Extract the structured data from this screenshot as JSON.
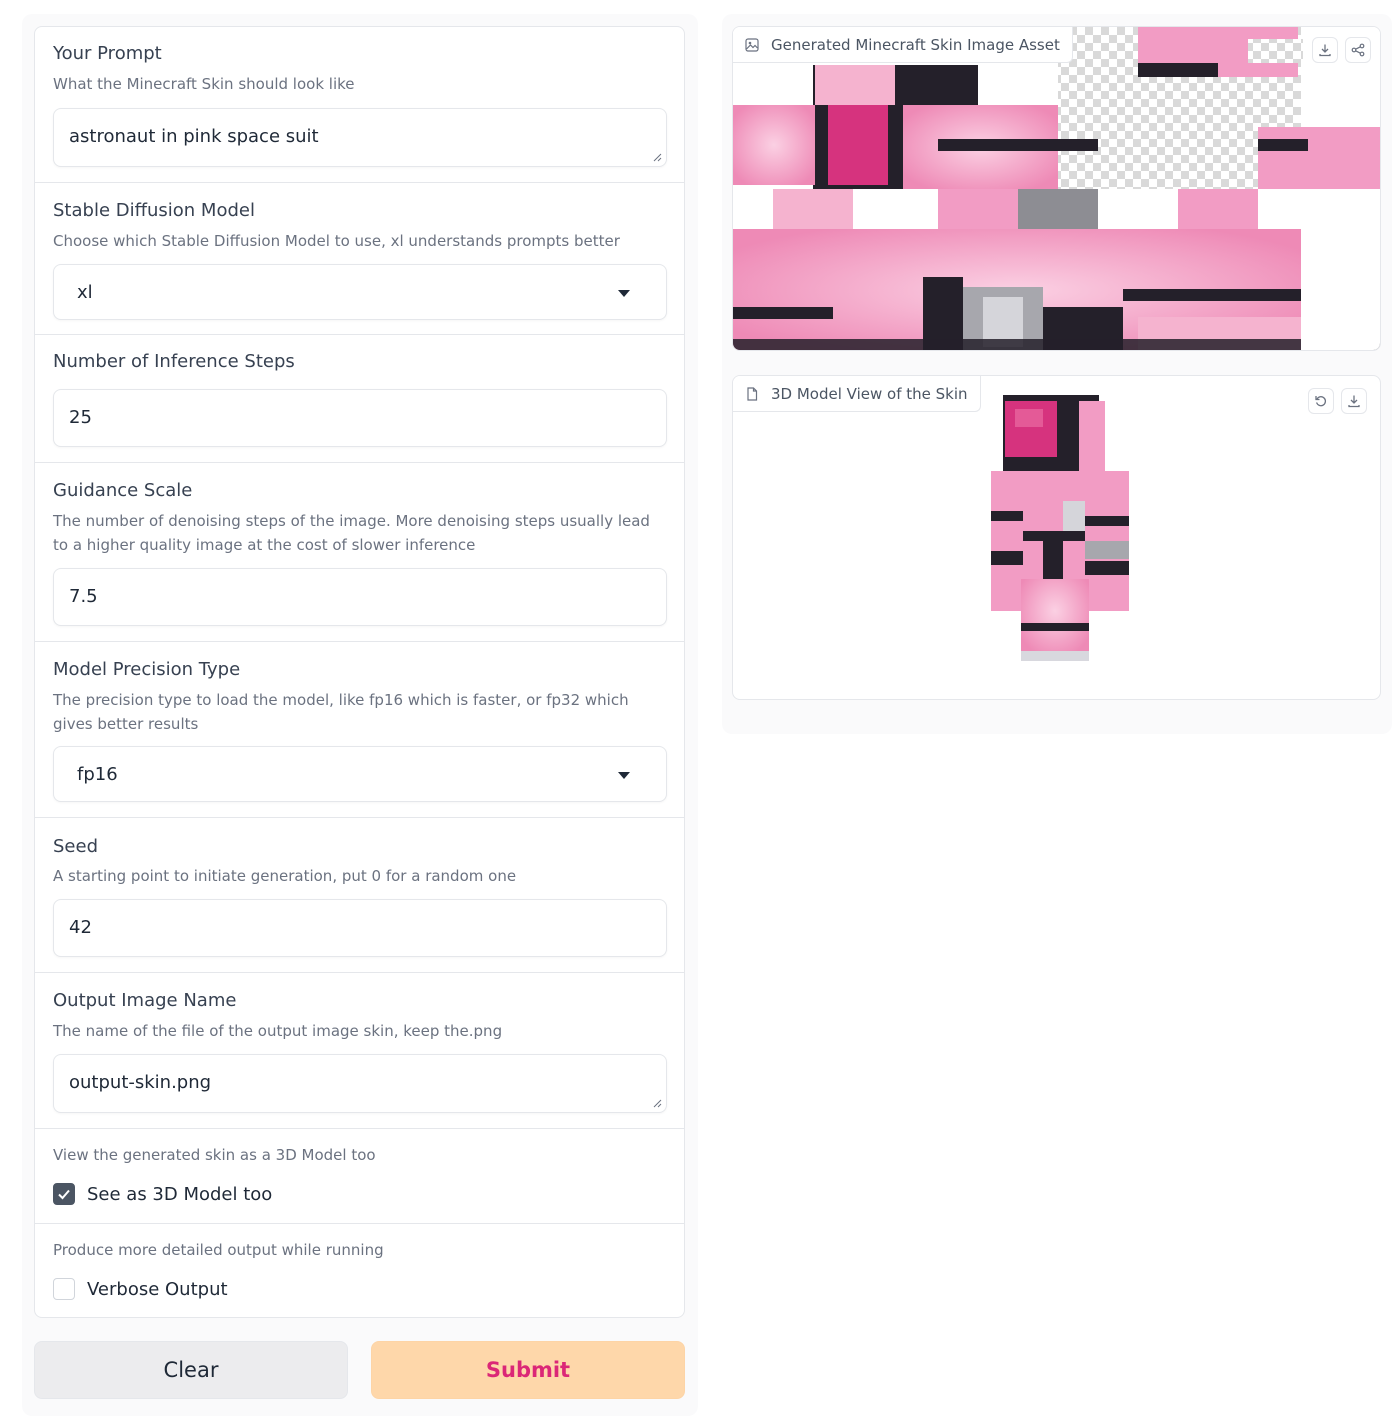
{
  "form": {
    "prompt": {
      "label": "Your Prompt",
      "info": "What the Minecraft Skin should look like",
      "value": "astronaut in pink space suit"
    },
    "model": {
      "label": "Stable Diffusion Model",
      "info": "Choose which Stable Diffusion Model to use, xl understands prompts better",
      "value": "xl"
    },
    "steps": {
      "label": "Number of Inference Steps",
      "value": "25"
    },
    "guidance": {
      "label": "Guidance Scale",
      "info": "The number of denoising steps of the image. More denoising steps usually lead to a higher quality image at the cost of slower inference",
      "value": "7.5"
    },
    "precision": {
      "label": "Model Precision Type",
      "info": "The precision type to load the model, like fp16 which is faster, or fp32 which gives better results",
      "value": "fp16"
    },
    "seed": {
      "label": "Seed",
      "info": "A starting point to initiate generation, put 0 for a random one",
      "value": "42"
    },
    "output_name": {
      "label": "Output Image Name",
      "info": "The name of the file of the output image skin, keep the.png",
      "value": "output-skin.png"
    },
    "model3d": {
      "info": "View the generated skin as a 3D Model too",
      "label": "See as 3D Model too",
      "checked": true
    },
    "verbose": {
      "info": "Produce more detailed output while running",
      "label": "Verbose Output",
      "checked": false
    }
  },
  "buttons": {
    "clear": "Clear",
    "submit": "Submit"
  },
  "outputs": {
    "image": {
      "label": "Generated Minecraft Skin Image Asset",
      "icons": [
        "download-icon",
        "share-icon"
      ]
    },
    "model3d": {
      "label": "3D Model View of the Skin",
      "icons": [
        "reset-view-icon",
        "download-icon"
      ]
    }
  },
  "colors": {
    "accent_pink": "#db2777",
    "submit_bg": "#fed7aa",
    "skin_pink": "#f29cc4",
    "skin_dark": "#24202a",
    "skin_magenta": "#d6337e"
  }
}
